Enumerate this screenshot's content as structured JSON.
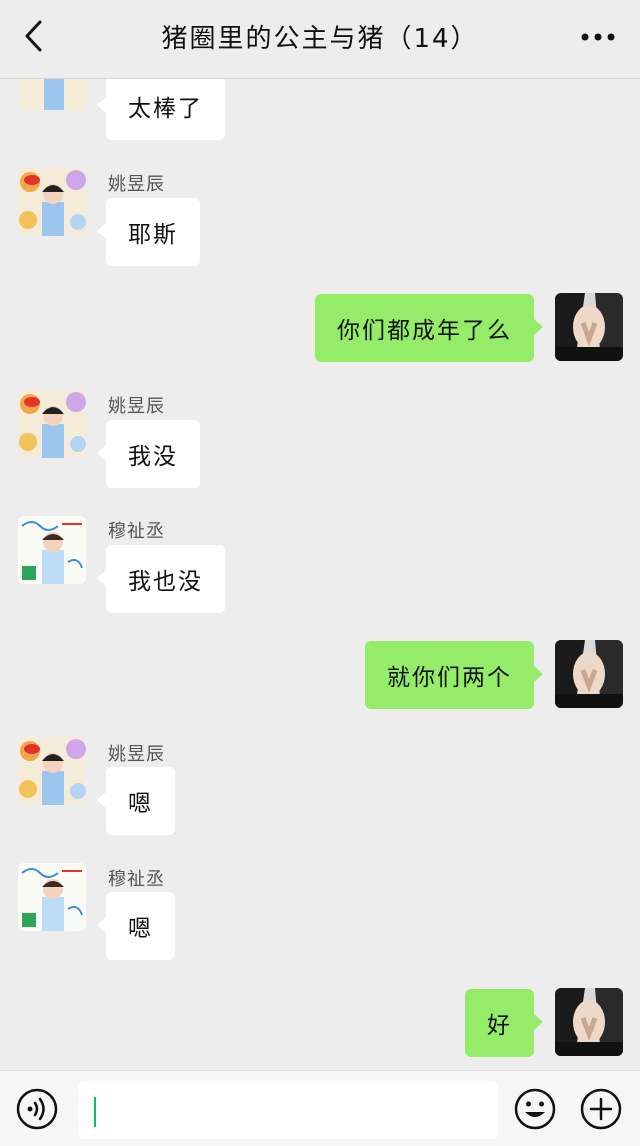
{
  "header": {
    "title": "猪圈里的公主与猪（14）",
    "back_icon": "chevron-left-icon",
    "more_icon": "more-dots-icon"
  },
  "messages": [
    {
      "side": "in",
      "sender": "",
      "text": "太棒了",
      "avatar": "avatar-yao-icon"
    },
    {
      "side": "in",
      "sender": "姚昱辰",
      "text": "耶斯",
      "avatar": "avatar-yao-icon"
    },
    {
      "side": "out",
      "sender": "",
      "text": "你们都成年了么",
      "avatar": "avatar-self-icon"
    },
    {
      "side": "in",
      "sender": "姚昱辰",
      "text": "我没",
      "avatar": "avatar-yao-icon"
    },
    {
      "side": "in",
      "sender": "穆祉丞",
      "text": "我也没",
      "avatar": "avatar-mu-icon"
    },
    {
      "side": "out",
      "sender": "",
      "text": "就你们两个",
      "avatar": "avatar-self-icon"
    },
    {
      "side": "in",
      "sender": "姚昱辰",
      "text": "嗯",
      "avatar": "avatar-yao-icon"
    },
    {
      "side": "in",
      "sender": "穆祉丞",
      "text": "嗯",
      "avatar": "avatar-mu-icon"
    },
    {
      "side": "out",
      "sender": "",
      "text": "好",
      "avatar": "avatar-self-icon"
    }
  ],
  "footer": {
    "input_value": "",
    "voice_icon": "voice-icon",
    "emoji_icon": "emoji-icon",
    "plus_icon": "plus-icon"
  },
  "colors": {
    "background": "#ededed",
    "incoming_bubble": "#ffffff",
    "outgoing_bubble": "#95ec69",
    "caret": "#07c160"
  }
}
